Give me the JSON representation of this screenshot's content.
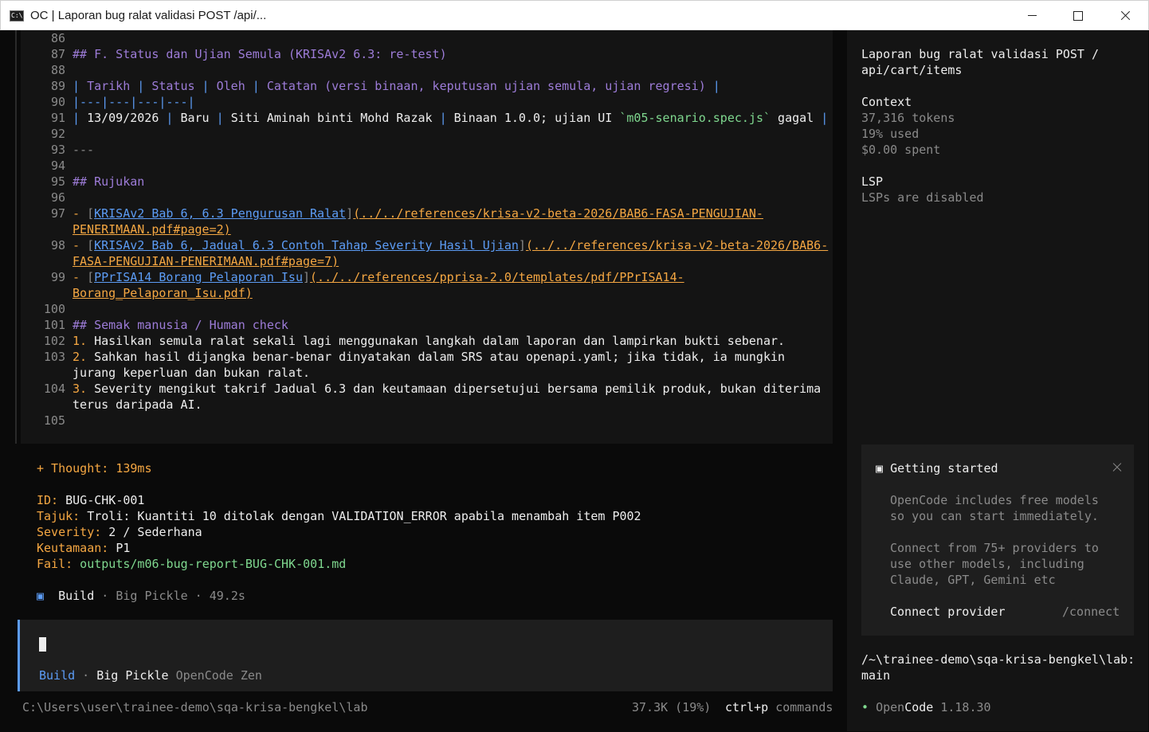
{
  "window": {
    "title": "OC | Laporan bug ralat validasi POST /api/..."
  },
  "editor": {
    "lines": {
      "l86": {
        "n": "86"
      },
      "l87": {
        "n": "87",
        "text": "## F. Status dan Ujian Semula (KRISAv2 6.3: re-test)"
      },
      "l88": {
        "n": "88"
      },
      "l89": {
        "n": "89",
        "c1": "Tarikh",
        "c2": "Status",
        "c3": "Oleh",
        "c4": "Catatan (versi binaan, keputusan ujian semula, ujian regresi)"
      },
      "l90": {
        "n": "90",
        "text": "|---|---|---|---|"
      },
      "l91": {
        "n": "91",
        "c1": "13/09/2026",
        "c2": "Baru",
        "c3": "Siti Aminah binti Mohd Razak",
        "c4a": "Binaan 1.0.0; ujian UI ",
        "c4code": "`m05-senario.spec.js`",
        "c4b": " gagal"
      },
      "l92": {
        "n": "92"
      },
      "l93": {
        "n": "93",
        "text": "---"
      },
      "l94": {
        "n": "94"
      },
      "l95": {
        "n": "95",
        "text": "## Rujukan"
      },
      "l96": {
        "n": "96"
      },
      "l97": {
        "n": "97",
        "bullet": "- ",
        "lt": "KRISAv2 Bab 6, 6.3 Pengurusan Ralat",
        "url1": "(../../references/krisa-v2-beta-2026/BAB6-FASA-PENGUJIAN-",
        "url2": "PENERIMAAN.pdf#page=2)"
      },
      "l98": {
        "n": "98",
        "bullet": "- ",
        "lt": "KRISAv2 Bab 6, Jadual 6.3 Contoh Tahap Severity Hasil Ujian",
        "url1": "(../../references/krisa-v2-beta-2026/BAB6-",
        "url2": "FASA-PENGUJIAN-PENERIMAAN.pdf#page=7)"
      },
      "l99": {
        "n": "99",
        "bullet": "- ",
        "lt": "PPrISA14 Borang Pelaporan Isu",
        "url1": "(../../references/pprisa-2.0/templates/pdf/PPrISA14-",
        "url2": "Borang_Pelaporan_Isu.pdf)"
      },
      "l100": {
        "n": "100"
      },
      "l101": {
        "n": "101",
        "text": "## Semak manusia / Human check"
      },
      "l102": {
        "n": "102",
        "num": "1.",
        "text": " Hasilkan semula ralat sekali lagi menggunakan langkah dalam laporan dan lampirkan bukti sebenar."
      },
      "l103": {
        "n": "103",
        "num": "2.",
        "text": " Sahkan hasil dijangka benar-benar dinyatakan dalam SRS atau openapi.yaml; jika tidak, ia mungkin",
        "text2": "jurang keperluan dan bukan ralat."
      },
      "l104": {
        "n": "104",
        "num": "3.",
        "text": " Severity mengikut takrif Jadual 6.3 dan keutamaan dipersetujui bersama pemilik produk, bukan diterima",
        "text2": "terus daripada AI."
      },
      "l105": {
        "n": "105"
      }
    }
  },
  "output": {
    "thought": "+ Thought: 139ms",
    "id_key": "ID:",
    "id_val": " BUG-CHK-001",
    "tajuk_key": "Tajuk:",
    "tajuk_val": " Troli: Kuantiti 10 ditolak dengan VALIDATION_ERROR apabila menambah item P002",
    "severity_key": "Severity:",
    "severity_val": " 2 / Sederhana",
    "keutamaan_key": "Keutamaan:",
    "keutamaan_val": " P1",
    "fail_key": "Fail:",
    "fail_val": " outputs/m06-bug-report-BUG-CHK-001.md",
    "build_icon": "▣",
    "build_label": "Build",
    "build_meta": " · Big Pickle · 49.2s"
  },
  "prompt": {
    "mode": "Build",
    "sep": " · ",
    "model": "Big Pickle",
    "provider": "OpenCode Zen"
  },
  "footer": {
    "path": "C:\\Users\\user\\trainee-demo\\sqa-krisa-bengkel\\lab",
    "usage": "37.3K (19%)",
    "shortcut": "ctrl+p",
    "shortcut_label": "commands"
  },
  "sidebar": {
    "title1": "Laporan bug ralat validasi POST /",
    "title2": "api/cart/items",
    "context_label": "Context",
    "tokens": "37,316 tokens",
    "used": "19% used",
    "spent": "$0.00 spent",
    "lsp_label": "LSP",
    "lsp_status": "LSPs are disabled",
    "getting_started": {
      "icon": "▣",
      "title": "Getting started",
      "p1a": "OpenCode includes free models",
      "p1b": "so you can start immediately.",
      "p2a": "Connect from 75+ providers to",
      "p2b": "use other models, including",
      "p2c": "Claude, GPT, Gemini etc",
      "action": "Connect provider",
      "command": "/connect"
    },
    "path1": "/~\\trainee-demo\\sqa-krisa-bengkel\\lab:",
    "path2": "main",
    "status_dot": "•",
    "app_open": "Open",
    "app_code": "Code",
    "version": " 1.18.30"
  }
}
